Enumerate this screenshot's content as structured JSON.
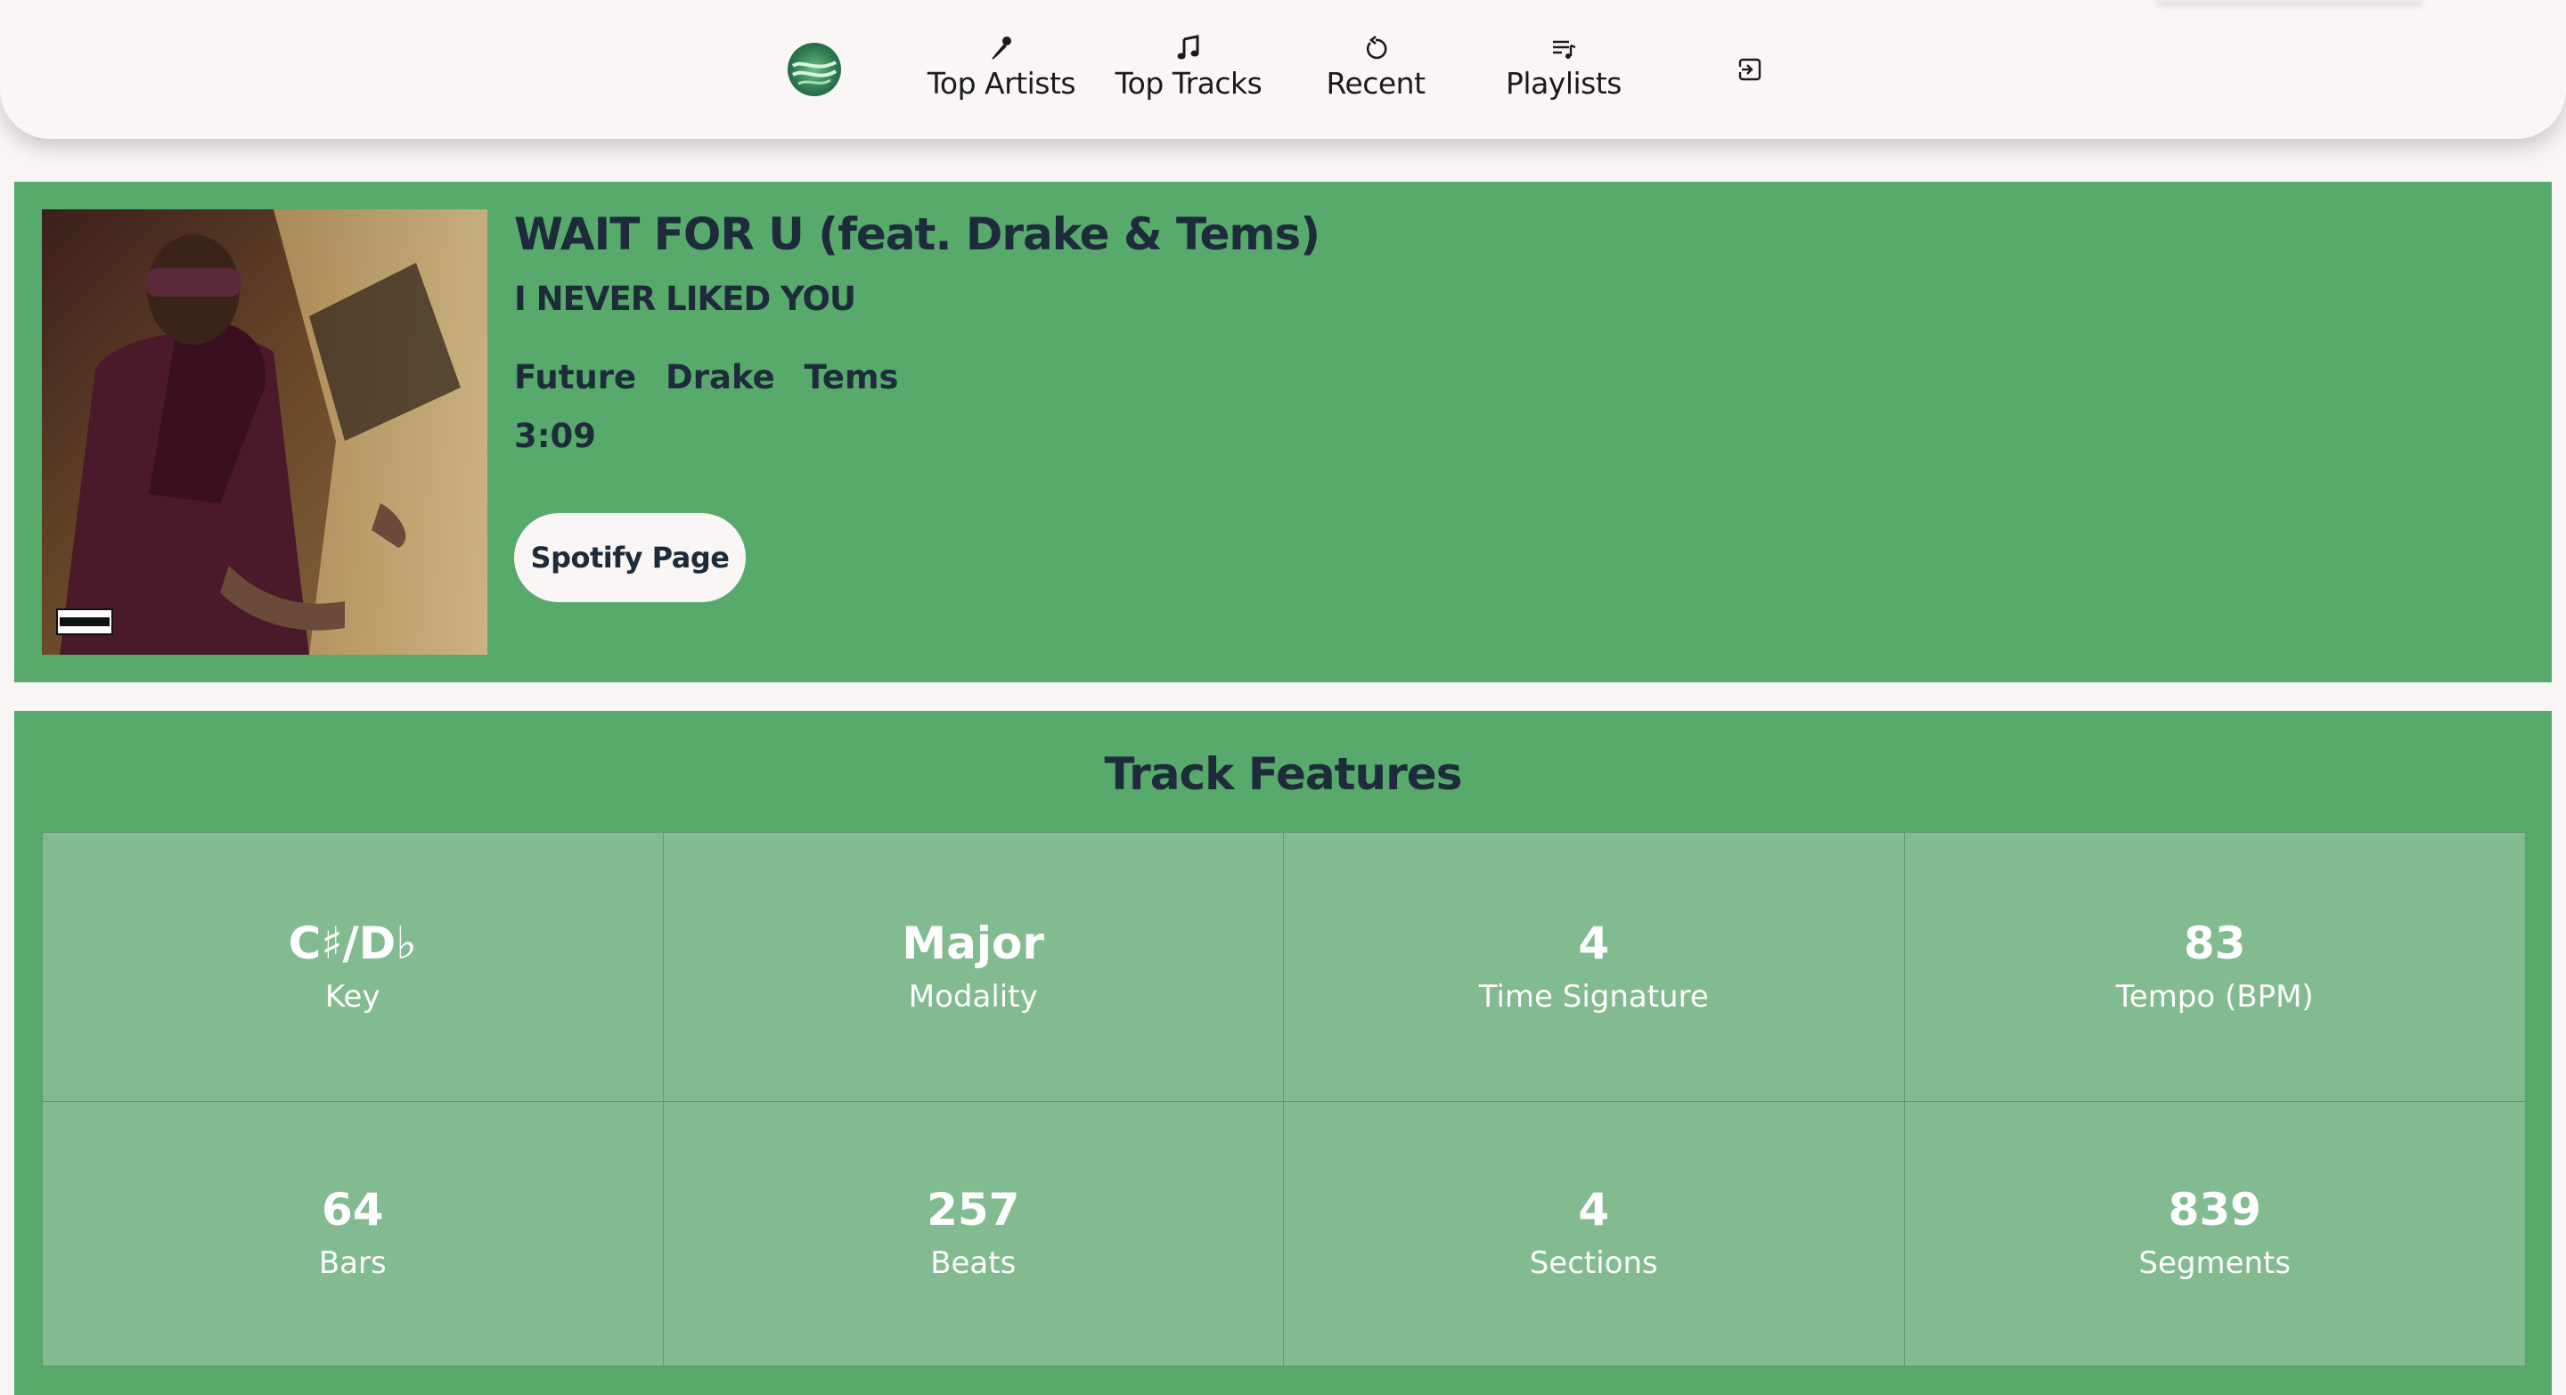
{
  "nav": {
    "items": [
      {
        "label": "Top Artists",
        "icon": "microphone-icon"
      },
      {
        "label": "Top Tracks",
        "icon": "music-note-icon"
      },
      {
        "label": "Recent",
        "icon": "history-icon"
      },
      {
        "label": "Playlists",
        "icon": "playlist-icon"
      }
    ],
    "logout_icon": "logout-icon"
  },
  "track": {
    "title": "WAIT FOR U (feat. Drake & Tems)",
    "album": "I NEVER LIKED YOU",
    "artists": [
      "Future",
      "Drake",
      "Tems"
    ],
    "duration": "3:09",
    "spotify_button": "Spotify Page",
    "advisory_text": "PARENTAL ADVISORY EXPLICIT CONTENT"
  },
  "features": {
    "title": "Track Features",
    "items": [
      {
        "value": "C♯/D♭",
        "label": "Key"
      },
      {
        "value": "Major",
        "label": "Modality"
      },
      {
        "value": "4",
        "label": "Time Signature"
      },
      {
        "value": "83",
        "label": "Tempo (BPM)"
      },
      {
        "value": "64",
        "label": "Bars"
      },
      {
        "value": "257",
        "label": "Beats"
      },
      {
        "value": "4",
        "label": "Sections"
      },
      {
        "value": "839",
        "label": "Segments"
      }
    ]
  },
  "colors": {
    "card_green": "#57aa6c",
    "cell_green": "#81bb8f",
    "text_dark": "#1d2b3a",
    "background": "#faf5f5"
  }
}
